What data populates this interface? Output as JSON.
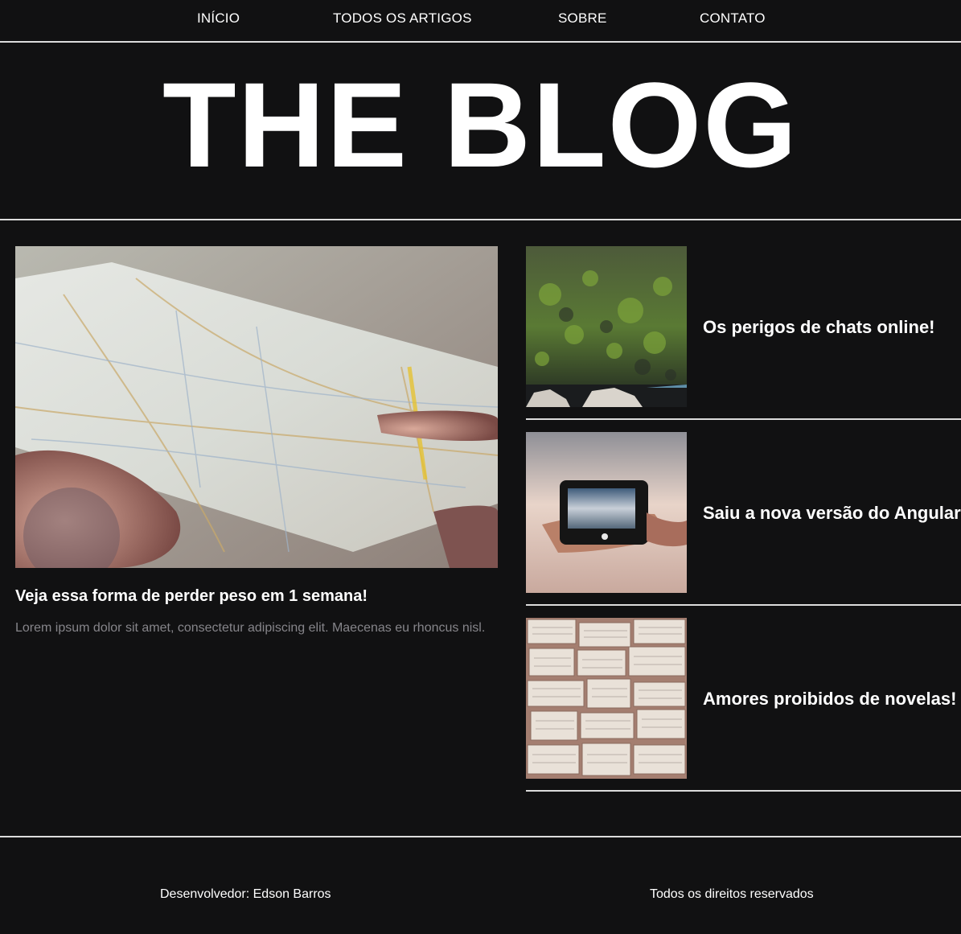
{
  "nav": {
    "items": [
      {
        "label": "INÍCIO"
      },
      {
        "label": "TODOS OS ARTIGOS"
      },
      {
        "label": "SOBRE"
      },
      {
        "label": "CONTATO"
      }
    ]
  },
  "header": {
    "title": "THE BLOG"
  },
  "featured": {
    "image": "map-photo",
    "title": "Veja essa forma de perder peso em 1 semana!",
    "excerpt": "Lorem ipsum dolor sit amet, consectetur adipiscing elit. Maecenas eu rhoncus nisl."
  },
  "side_posts": [
    {
      "image": "mossy-rock-photo",
      "title": "Os perigos de chats online!"
    },
    {
      "image": "phone-in-hand-photo",
      "title": "Saiu a nova versão do Angular"
    },
    {
      "image": "open-books-photo",
      "title": "Amores proibidos de novelas!"
    }
  ],
  "footer": {
    "developer": "Desenvolvedor: Edson Barros",
    "rights": "Todos os direitos reservados"
  },
  "colors": {
    "background": "#111112",
    "text": "#ffffff",
    "muted_text": "#86858a",
    "divider": "#dcdcdc"
  }
}
